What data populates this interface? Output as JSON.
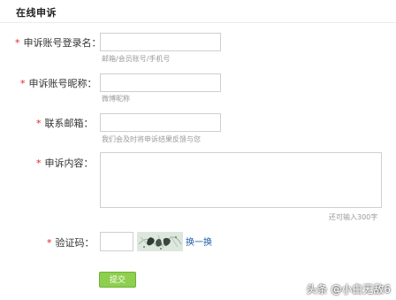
{
  "page": {
    "title": "在线申诉"
  },
  "form": {
    "required_mark": "*",
    "account": {
      "label": "申诉账号登录名：",
      "value": "",
      "hint": "邮箱/会员账号/手机号"
    },
    "nickname": {
      "label": "申诉账号昵称：",
      "value": "",
      "hint": "微博昵称"
    },
    "email": {
      "label": "联系邮箱：",
      "value": "",
      "hint": "我们会及时将申诉结果反馈与您"
    },
    "content": {
      "label": "申诉内容：",
      "value": "",
      "counter": "还可输入300字"
    },
    "captcha": {
      "label": "验证码：",
      "value": "",
      "refresh_label": "换一换"
    },
    "submit_label": "提交"
  },
  "watermark": "头条 @小白无敌6",
  "colors": {
    "required_star": "#d9262c",
    "submit_bg": "#8fcf4f",
    "link": "#1f5fa9",
    "hint": "#9a9a9a"
  }
}
